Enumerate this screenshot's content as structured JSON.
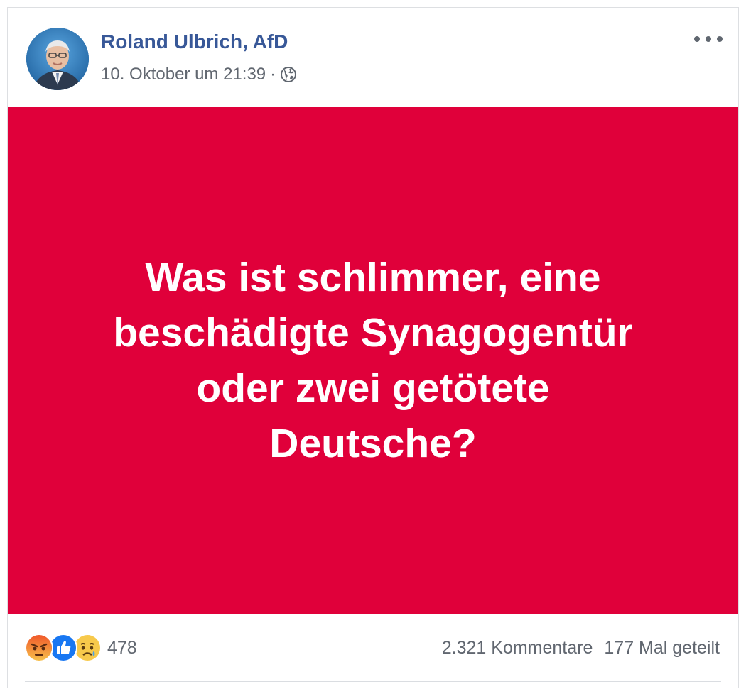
{
  "post": {
    "author": "Roland Ulbrich, AfD",
    "timestamp": "10. Oktober um 21:39",
    "separator": "·",
    "privacy_icon": "globe-icon",
    "more_icon": "more-options-icon",
    "text": "Was ist schlimmer, eine\nbeschädigte Synagogentür\noder zwei getötete\nDeutsche?",
    "background_color": "#e0003a"
  },
  "footer": {
    "reactions": [
      "angry-reaction-icon",
      "like-reaction-icon",
      "sad-reaction-icon"
    ],
    "reaction_count": "478",
    "comments": "2.321 Kommentare",
    "shares": "177 Mal geteilt"
  },
  "colors": {
    "author_link": "#385898",
    "meta_text": "#616770",
    "like_blue": "#1877f2"
  }
}
